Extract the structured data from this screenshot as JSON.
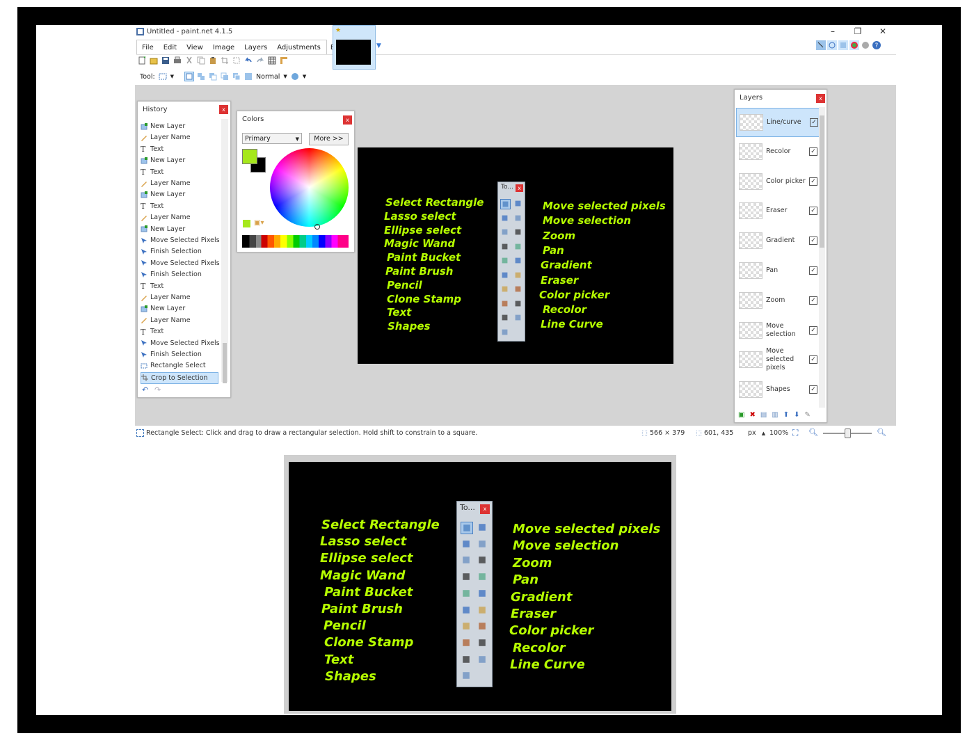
{
  "window": {
    "title": "Untitled - paint.net 4.1.5",
    "controls": [
      "–",
      "❐",
      "✕"
    ]
  },
  "menu": [
    "File",
    "Edit",
    "View",
    "Image",
    "Layers",
    "Adjustments",
    "Effects"
  ],
  "toolbar2": {
    "tool_label": "Tool:",
    "blend_mode": "Normal"
  },
  "history": {
    "title": "History",
    "items": [
      {
        "label": "New Layer",
        "icon": "new-layer"
      },
      {
        "label": "Layer Name",
        "icon": "layer-name"
      },
      {
        "label": "Text",
        "icon": "text"
      },
      {
        "label": "New Layer",
        "icon": "new-layer"
      },
      {
        "label": "Text",
        "icon": "text"
      },
      {
        "label": "Layer Name",
        "icon": "layer-name"
      },
      {
        "label": "New Layer",
        "icon": "new-layer"
      },
      {
        "label": "Text",
        "icon": "text"
      },
      {
        "label": "Layer Name",
        "icon": "layer-name"
      },
      {
        "label": "New Layer",
        "icon": "new-layer"
      },
      {
        "label": "Move Selected Pixels",
        "icon": "move"
      },
      {
        "label": "Finish Selection",
        "icon": "move"
      },
      {
        "label": "Move Selected Pixels",
        "icon": "move"
      },
      {
        "label": "Finish Selection",
        "icon": "move"
      },
      {
        "label": "Text",
        "icon": "text"
      },
      {
        "label": "Layer Name",
        "icon": "layer-name"
      },
      {
        "label": "New Layer",
        "icon": "new-layer"
      },
      {
        "label": "Layer Name",
        "icon": "layer-name"
      },
      {
        "label": "Text",
        "icon": "text"
      },
      {
        "label": "Move Selected Pixels",
        "icon": "move"
      },
      {
        "label": "Finish Selection",
        "icon": "move"
      },
      {
        "label": "Rectangle Select",
        "icon": "rect-select"
      },
      {
        "label": "Crop to Selection",
        "icon": "crop"
      }
    ]
  },
  "colors": {
    "title": "Colors",
    "dropdown": "Primary",
    "more_button": "More >>",
    "primary": "#a6e81c",
    "secondary": "#000000"
  },
  "canvas_text": {
    "left": [
      "Select Rectangle",
      "Lasso select",
      "Ellipse select",
      "Magic Wand",
      "Paint Bucket",
      "Paint Brush",
      "Pencil",
      "Clone Stamp",
      "Text",
      "Shapes"
    ],
    "right": [
      "Move selected pixels",
      "Move selection",
      "Zoom",
      "Pan",
      "Gradient",
      "Eraser",
      "Color picker",
      "Recolor",
      "Line Curve"
    ],
    "toolbox_title": "To...",
    "text_color": "#b6ff00"
  },
  "layers": {
    "title": "Layers",
    "items": [
      "Line/curve",
      "Recolor",
      "Color picker",
      "Eraser",
      "Gradient",
      "Pan",
      "Zoom",
      "Move selection",
      "Move selected pixels",
      "Shapes"
    ]
  },
  "status": {
    "hint": "Rectangle Select: Click and drag to draw a rectangular selection. Hold shift to constrain to a square.",
    "size": "566 × 379",
    "position": "601, 435",
    "unit": "px",
    "zoom": "100%"
  }
}
